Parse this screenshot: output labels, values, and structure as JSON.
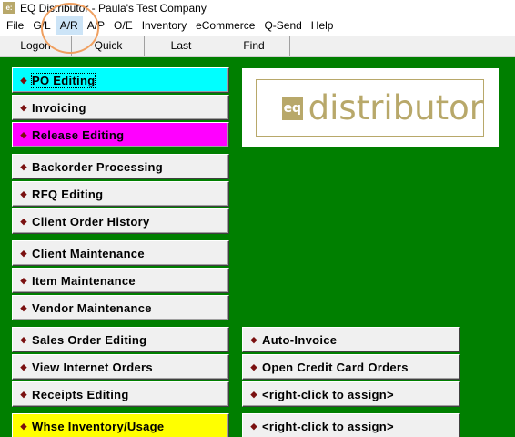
{
  "window": {
    "title": "EQ Distributor - Paula's Test Company",
    "icon_text": "e:"
  },
  "menubar": {
    "items": [
      "File",
      "G/L",
      "A/R",
      "A/P",
      "O/E",
      "Inventory",
      "eCommerce",
      "Q-Send",
      "Help"
    ],
    "active_item": "A/R"
  },
  "toolbar": {
    "buttons": [
      "Logon",
      "Quick",
      "Last",
      "Find"
    ]
  },
  "logo": {
    "mark": "eq",
    "text": "distributor"
  },
  "left_buttons": [
    {
      "label": "PO Editing",
      "color": "#00ffff",
      "focused": true
    },
    {
      "label": "Invoicing"
    },
    {
      "label": "Release Editing",
      "color": "#ff00ff"
    },
    {
      "label": "Backorder Processing"
    },
    {
      "label": "RFQ Editing"
    },
    {
      "label": "Client Order History"
    },
    {
      "label": "Client Maintenance"
    },
    {
      "label": "Item Maintenance"
    },
    {
      "label": "Vendor Maintenance"
    },
    {
      "label": "Sales Order Editing"
    },
    {
      "label": "View Internet Orders"
    },
    {
      "label": "Receipts Editing"
    },
    {
      "label": "Whse Inventory/Usage",
      "color": "#ffff00"
    }
  ],
  "right_buttons": [
    {
      "label": "Auto-Invoice"
    },
    {
      "label": "Open Credit Card Orders"
    },
    {
      "label": "<right-click to assign>"
    },
    {
      "label": "<right-click to assign>"
    }
  ],
  "bullet_icon": "diamond-bullet-icon",
  "colors": {
    "background": "#007f00",
    "bullet": "#7a1010",
    "logo_gold": "#b8a86a"
  }
}
